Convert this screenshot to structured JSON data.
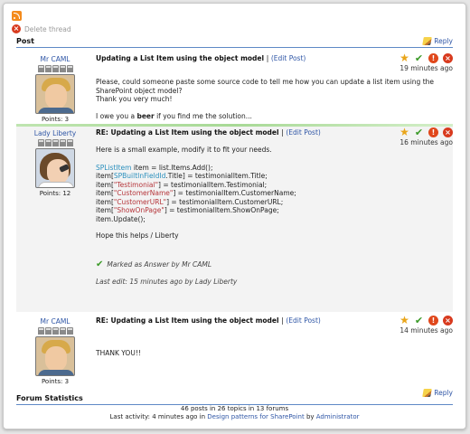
{
  "toolbar": {
    "delete_label": "Delete thread"
  },
  "header": {
    "title": "Post",
    "reply_label": "Reply"
  },
  "footer": {
    "title": "Forum Statistics",
    "reply_label": "Reply"
  },
  "posts": [
    {
      "author": "Mr CAML",
      "points": "Points: 3",
      "title": "Updating a List Item using the object model",
      "sep": "|",
      "edit": "(Edit Post)",
      "time": "19 minutes ago",
      "lines": [
        "Please, could someone paste some source code to tell me how you can update a list item using the SharePoint object model?",
        "Thank you very much!",
        "",
        "I owe you a ",
        "beer",
        " if you find me the solution..."
      ]
    },
    {
      "author": "Lady Liberty",
      "points": "Points: 12",
      "title": "RE: Updating a List Item using the object model",
      "sep": "|",
      "edit": "(Edit Post)",
      "time": "16 minutes ago",
      "intro": "Here is a small example, modify it to fit your needs.",
      "code": {
        "l1a": "SPListItem",
        "l1b": " item = list.Items.Add();",
        "l2a": "item[",
        "l2b": "SPBuiltInFieldId",
        "l2c": ".Title] = testimonialItem.Title;",
        "l3a": "item[",
        "l3b": "\"Testimonial\"",
        "l3c": "] = testimonialItem.Testimonial;",
        "l4a": "item[",
        "l4b": "\"CustomerName\"",
        "l4c": "] = testimonialItem.CustomerName;",
        "l5a": "item[",
        "l5b": "\"CustomerURL\"",
        "l5c": "] = testimonialItem.CustomerURL;",
        "l6a": "item[",
        "l6b": "\"ShowOnPage\"",
        "l6c": "] = testimonialItem.ShowOnPage;",
        "l7": "item.Update();"
      },
      "outro": "Hope this helps / Liberty",
      "answered": "Marked as Answer by Mr CAML",
      "last_edit": "Last edit: 15 minutes ago by Lady Liberty"
    },
    {
      "author": "Mr CAML",
      "points": "Points: 3",
      "title": "RE: Updating a List Item using the object model",
      "sep": "|",
      "edit": "(Edit Post)",
      "time": "14 minutes ago",
      "text": "THANK YOU!!"
    }
  ],
  "stats": {
    "line1": "46 posts in 26 topics in 13 forums",
    "line2a": "Last activity: 4 minutes ago in ",
    "line2_link": "Design patterns for SharePoint",
    "line2b": " by ",
    "line2_user": "Administrator"
  },
  "icons": [
    "rss-icon",
    "delete-icon",
    "pencil-icon",
    "star-icon",
    "check-icon",
    "alert-icon",
    "close-icon"
  ],
  "colors": {
    "link": "#2f56a6",
    "accent_line": "#5e89c6",
    "answer_green": "#3b9a28",
    "danger": "#d83a1e"
  }
}
